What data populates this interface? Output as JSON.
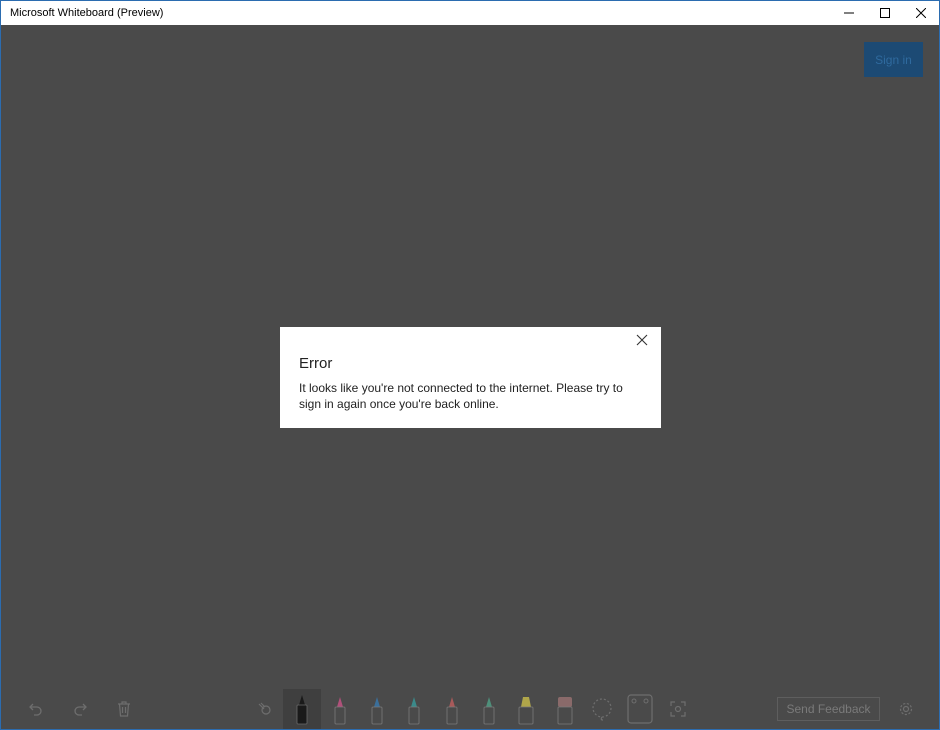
{
  "window": {
    "title": "Microsoft Whiteboard (Preview)"
  },
  "header": {
    "sign_in_label": "Sign in"
  },
  "dialog": {
    "title": "Error",
    "message": "It looks like you're not connected to the internet. Please try to sign in again once you're back online."
  },
  "toolbar": {
    "left_tools": [
      "undo-icon",
      "redo-icon",
      "trash-icon"
    ],
    "pens": [
      {
        "name": "black-pen",
        "color": "#1a1a1a",
        "selected": true
      },
      {
        "name": "pink-pen",
        "color": "#b0507a"
      },
      {
        "name": "blue-pen",
        "color": "#3b6f9a"
      },
      {
        "name": "teal-pen",
        "color": "#3b8a8a"
      },
      {
        "name": "red-pen",
        "color": "#a85a5a"
      },
      {
        "name": "green-pen",
        "color": "#4e8f7a"
      },
      {
        "name": "yellow-highlighter",
        "color": "#b0a64a"
      },
      {
        "name": "eraser",
        "color": "#8a6a6a"
      }
    ],
    "extra_tools": [
      "lasso-icon",
      "ruler-icon",
      "touch-select-icon"
    ],
    "send_feedback_label": "Send Feedback"
  },
  "colors": {
    "canvas": "#4a4a4a",
    "sign_in_bg": "#1c4a74",
    "window_border": "#2b6cb0"
  }
}
